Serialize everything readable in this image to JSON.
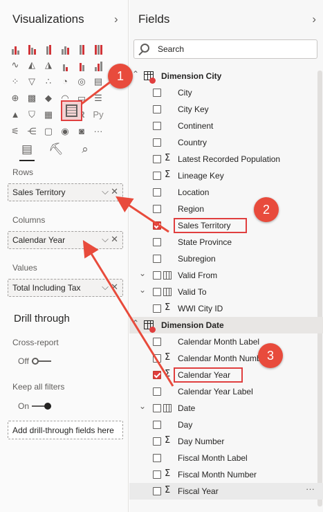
{
  "viz": {
    "title": "Visualizations",
    "rows_label": "Rows",
    "rows_value": "Sales Territory",
    "columns_label": "Columns",
    "columns_value": "Calendar Year",
    "values_label": "Values",
    "values_value": "Total Including Tax",
    "drill_title": "Drill through",
    "cross_report_label": "Cross-report",
    "cross_report_state": "Off",
    "keep_filters_label": "Keep all filters",
    "keep_filters_state": "On",
    "add_drill_text": "Add drill-through fields here",
    "more_glyph": "···"
  },
  "fields": {
    "title": "Fields",
    "search_placeholder": "Search",
    "tables": [
      {
        "name": "Dimension City",
        "items": [
          {
            "label": "City",
            "checked": false,
            "sigma": false
          },
          {
            "label": "City Key",
            "checked": false,
            "sigma": false
          },
          {
            "label": "Continent",
            "checked": false,
            "sigma": false
          },
          {
            "label": "Country",
            "checked": false,
            "sigma": false
          },
          {
            "label": "Latest Recorded Population",
            "checked": false,
            "sigma": true
          },
          {
            "label": "Lineage Key",
            "checked": false,
            "sigma": true
          },
          {
            "label": "Location",
            "checked": false,
            "sigma": false
          },
          {
            "label": "Region",
            "checked": false,
            "sigma": false
          },
          {
            "label": "Sales Territory",
            "checked": true,
            "sigma": false
          },
          {
            "label": "State Province",
            "checked": false,
            "sigma": false
          },
          {
            "label": "Subregion",
            "checked": false,
            "sigma": false
          },
          {
            "label": "Valid From",
            "checked": false,
            "sigma": false,
            "date": true
          },
          {
            "label": "Valid To",
            "checked": false,
            "sigma": false,
            "date": true
          },
          {
            "label": "WWI City ID",
            "checked": false,
            "sigma": true
          }
        ]
      },
      {
        "name": "Dimension Date",
        "items": [
          {
            "label": "Calendar Month Label",
            "checked": false,
            "sigma": false
          },
          {
            "label": "Calendar Month Number",
            "checked": false,
            "sigma": true
          },
          {
            "label": "Calendar Year",
            "checked": true,
            "sigma": true
          },
          {
            "label": "Calendar Year Label",
            "checked": false,
            "sigma": false
          },
          {
            "label": "Date",
            "checked": false,
            "sigma": false,
            "date": true
          },
          {
            "label": "Day",
            "checked": false,
            "sigma": false
          },
          {
            "label": "Day Number",
            "checked": false,
            "sigma": true
          },
          {
            "label": "Fiscal Month Label",
            "checked": false,
            "sigma": false
          },
          {
            "label": "Fiscal Month Number",
            "checked": false,
            "sigma": true
          },
          {
            "label": "Fiscal Year",
            "checked": false,
            "sigma": true
          }
        ]
      }
    ]
  },
  "callouts": [
    "1",
    "2",
    "3"
  ],
  "colors": {
    "accent_red": "#e03e3e",
    "badge_red": "#e84b3c"
  }
}
